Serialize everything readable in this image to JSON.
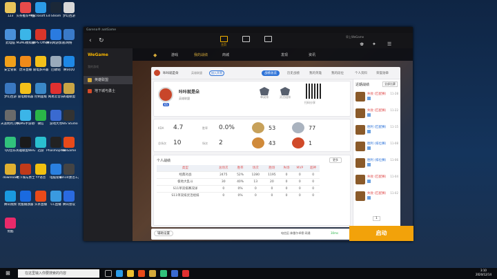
{
  "desktop": {
    "icons": [
      {
        "label": "123",
        "color": "#e8c45a"
      },
      {
        "label": "头条推荐中国",
        "color": "#e84a4a"
      },
      {
        "label": "Microsoft Edge",
        "color": "#2b9be8"
      },
      {
        "label": "Steam",
        "color": "#1b2838"
      },
      {
        "label": "梦幻西游",
        "color": "#d8d8d8"
      },
      {
        "label": "此电脑",
        "color": "#4a90d9"
      },
      {
        "label": "MuMu模拟器",
        "color": "#3bb5e8"
      },
      {
        "label": "WPS Office",
        "color": "#d8352a"
      },
      {
        "label": "腾讯网游加速器",
        "color": "#2a7be0"
      },
      {
        "label": "网络",
        "color": "#3a7ac8"
      },
      {
        "label": "安全管家",
        "color": "#f0a01a"
      },
      {
        "label": "虎牙直播",
        "color": "#f08a1a"
      },
      {
        "label": "雷电多开器",
        "color": "#f3c01a"
      },
      {
        "label": "回收站",
        "color": "#9ab"
      },
      {
        "label": "腾讯QQ",
        "color": "#1e88e5"
      },
      {
        "label": "梦幻西游",
        "color": "#3a78c0"
      },
      {
        "label": "雷电模拟器",
        "color": "#f3c01a"
      },
      {
        "label": "控制面板",
        "color": "#3a88c8"
      },
      {
        "label": "网易云音乐",
        "color": "#e03030"
      },
      {
        "label": "英雄联盟",
        "color": "#c9a545"
      },
      {
        "label": "天涯明月刀手游",
        "color": "#6a6a6a"
      },
      {
        "label": "MuMu手游助手",
        "color": "#3bb5e8"
      },
      {
        "label": "微信",
        "color": "#2ab548"
      },
      {
        "label": "游戏大厅",
        "color": "#3a6ad0"
      },
      {
        "label": "OBS Studio",
        "color": "#333"
      },
      {
        "label": "QQ音乐",
        "color": "#31c27c"
      },
      {
        "label": "英雄联盟WeGame版",
        "color": "#1a1a1a"
      },
      {
        "label": "迅游",
        "color": "#2ac0d0"
      },
      {
        "label": "PhasmophobiA",
        "color": "#222"
      },
      {
        "label": "WeGame",
        "color": "#e84a1a"
      },
      {
        "label": "download",
        "color": "#e0b030"
      },
      {
        "label": "地下城与勇士",
        "color": "#c03a1a"
      },
      {
        "label": "YY语音",
        "color": "#f0c010"
      },
      {
        "label": "电脑管家",
        "color": "#2a80e0"
      },
      {
        "label": "win10激活工具",
        "color": "#444"
      },
      {
        "label": "腾讯视频",
        "color": "#1a9ae0"
      },
      {
        "label": "优酷播放器",
        "color": "#1a6ae0"
      },
      {
        "label": "头条直播",
        "color": "#e84a1a"
      },
      {
        "label": "CC直播",
        "color": "#3a9ae0"
      },
      {
        "label": "腾讯会议",
        "color": "#2a6ae0"
      },
      {
        "label": "优酷",
        "color": "#e82a6a"
      }
    ]
  },
  "window": {
    "title": "Garena® aatGame",
    "user": "早上WeGame",
    "top_tabs": [
      {
        "label": "主页"
      },
      {
        "label": ""
      },
      {
        "label": ""
      }
    ]
  },
  "sidebar": {
    "logo": "WeGame",
    "section": "我的游戏",
    "items": [
      {
        "label": "英雄联盟",
        "color": "#d4a93a"
      },
      {
        "label": "地下城与勇士",
        "color": "#d54a2a"
      }
    ]
  },
  "lolnav": [
    "游戏",
    "我的战绩",
    "商城",
    "",
    "发现",
    "资讯"
  ],
  "profile": {
    "tabs": [
      "战绩总览",
      "历史战绩",
      "我的英雄",
      "我的段位",
      "个人资料",
      "荣誉勋章"
    ],
    "name": "咔咔就是朵",
    "tag": "加入开黑",
    "server": "英雄联盟",
    "level": "65",
    "stats": [
      {
        "label": "KDA",
        "value": "4.7"
      },
      {
        "label": "胜率",
        "value": "0.0%"
      },
      {
        "label": "总场次",
        "value": "10"
      },
      {
        "label": "场次",
        "value": "2"
      }
    ],
    "ranks": [
      {
        "value": "53"
      },
      {
        "value": "77"
      },
      {
        "value": "43"
      },
      {
        "value": "1"
      }
    ],
    "rank_labels": [
      "单双排",
      "灵活组排"
    ],
    "qr_label": "扫码分享"
  },
  "table": {
    "title": "个人战绩",
    "more": "更多",
    "headers": [
      "类型",
      "总场次",
      "胜率",
      "场次",
      "胜场",
      "失场",
      "MVP",
      "超神"
    ],
    "rows": [
      [
        "经典对战",
        "2475",
        "52%",
        "1280",
        "1195",
        "0",
        "0",
        "0"
      ],
      [
        "极地大乱斗",
        "30",
        "40%",
        "13",
        "20",
        "0",
        "0",
        "0"
      ],
      [
        "S11单双排赛况详",
        "0",
        "0%",
        "0",
        "0",
        "0",
        "0",
        "0"
      ],
      [
        "S11单双排灵活组排",
        "0",
        "0%",
        "0",
        "0",
        "0",
        "0",
        "0"
      ]
    ]
  },
  "recent": {
    "title": "近期战绩",
    "filter": "全部比赛",
    "items": [
      {
        "result": "失败 (匹配赛)",
        "date": "11-28"
      },
      {
        "result": "失败 (匹配赛)",
        "date": "11-22"
      },
      {
        "result": "胜利 (匹配赛)",
        "date": "11-15"
      },
      {
        "result": "胜利 (排位赛)",
        "date": "11-08"
      },
      {
        "result": "胜利 (排位赛)",
        "date": "11-06"
      },
      {
        "result": "失败 (匹配赛)",
        "date": "11-04"
      },
      {
        "result": "失败 (匹配赛)",
        "date": "11-02"
      }
    ],
    "pager": "1"
  },
  "bottom": {
    "assist": "辅助设置",
    "region": "电信区·弗雷尔卓德 网通",
    "ping": "30ms",
    "launch": "启动"
  },
  "taskbar": {
    "search_placeholder": "在这里输入你要搜索的内容",
    "time": "3:10",
    "date": "2020/12/14"
  }
}
